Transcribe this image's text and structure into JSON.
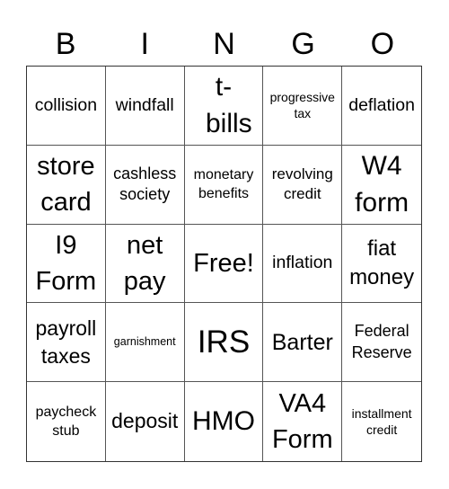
{
  "header": {
    "letters": [
      "B",
      "I",
      "N",
      "G",
      "O"
    ]
  },
  "cells": [
    {
      "text": "collision"
    },
    {
      "text": "windfall"
    },
    {
      "text": "t-bills"
    },
    {
      "text": "progressive tax"
    },
    {
      "text": "deflation"
    },
    {
      "text": "store card"
    },
    {
      "text": "cashless society"
    },
    {
      "text": "monetary benefits"
    },
    {
      "text": "revolving credit"
    },
    {
      "text": "W4 form"
    },
    {
      "text": "I9 Form"
    },
    {
      "text": "net pay"
    },
    {
      "text": "Free!"
    },
    {
      "text": "inflation"
    },
    {
      "text": "fiat money"
    },
    {
      "text": "payroll taxes"
    },
    {
      "text": "garnishment"
    },
    {
      "text": "IRS"
    },
    {
      "text": "Barter"
    },
    {
      "text": "Federal Reserve"
    },
    {
      "text": "paycheck stub"
    },
    {
      "text": "deposit"
    },
    {
      "text": "HMO"
    },
    {
      "text": "VA4 Form"
    },
    {
      "text": "installment credit"
    }
  ],
  "colors": {
    "background": "#ffffff",
    "text": "#000000",
    "grid_line": "#555555"
  }
}
